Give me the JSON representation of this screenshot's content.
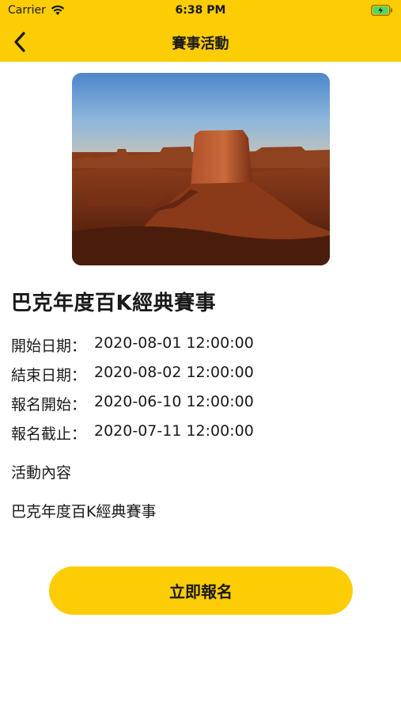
{
  "status_bar": {
    "carrier": "Carrier",
    "time": "6:38 PM"
  },
  "nav": {
    "title": "賽事活動",
    "back_icon": "chevron-left-icon"
  },
  "event": {
    "title": "巴克年度百K經典賽事",
    "start_label": "開始日期：",
    "start_value": "2020-08-01 12:00:00",
    "end_label": "結束日期：",
    "end_value": "2020-08-02 12:00:00",
    "reg_start_label": "報名開始：",
    "reg_start_value": "2020-06-10 12:00:00",
    "reg_end_label": "報名截止：",
    "reg_end_value": "2020-07-11 12:00:00",
    "content_label": "活動內容",
    "content_body": "巴克年度百K經典賽事"
  },
  "cta": {
    "label": "立即報名"
  },
  "colors": {
    "accent": "#fccc05",
    "text": "#1a1a1a",
    "background": "#ffffff"
  }
}
